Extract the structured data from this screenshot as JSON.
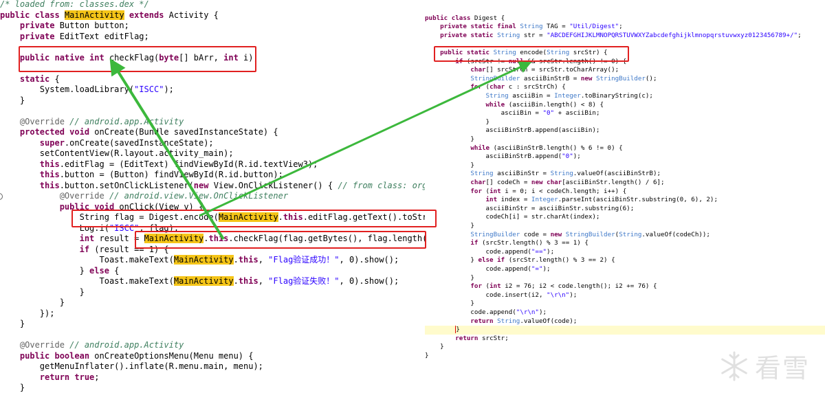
{
  "left_lines": [
    [
      [
        "cm",
        "/* loaded from: classes.dex */"
      ]
    ],
    [
      [
        "kw",
        "public class "
      ],
      [
        "hl",
        "MainActivity"
      ],
      [
        "kw",
        " extends "
      ],
      [
        "t",
        "Activity {"
      ]
    ],
    [
      [
        "t",
        "    "
      ],
      [
        "kw",
        "private "
      ],
      [
        "t",
        "Button button;"
      ]
    ],
    [
      [
        "t",
        "    "
      ],
      [
        "kw",
        "private "
      ],
      [
        "t",
        "EditText editFlag;"
      ]
    ],
    [],
    [
      [
        "t",
        "    "
      ],
      [
        "kw",
        "public native int "
      ],
      [
        "t",
        "checkFlag("
      ],
      [
        "kw",
        "byte"
      ],
      [
        "t",
        "[] bArr, "
      ],
      [
        "kw",
        "int "
      ],
      [
        "t",
        "i);"
      ]
    ],
    [],
    [
      [
        "t",
        "    "
      ],
      [
        "kw",
        "static "
      ],
      [
        "t",
        "{"
      ]
    ],
    [
      [
        "t",
        "        System.loadLibrary("
      ],
      [
        "str",
        "\"ISCC\""
      ],
      [
        "t",
        ");"
      ]
    ],
    [
      [
        "t",
        "    }"
      ]
    ],
    [],
    [
      [
        "t",
        "    "
      ],
      [
        "an",
        "@Override "
      ],
      [
        "cm",
        "// android.app.Activity"
      ]
    ],
    [
      [
        "t",
        "    "
      ],
      [
        "kw",
        "protected void "
      ],
      [
        "t",
        "onCreate(Bundle savedInstanceState) {"
      ]
    ],
    [
      [
        "t",
        "        "
      ],
      [
        "kw",
        "super"
      ],
      [
        "t",
        ".onCreate(savedInstanceState);"
      ]
    ],
    [
      [
        "t",
        "        setContentView(R.layout.activity_main);"
      ]
    ],
    [
      [
        "t",
        "        "
      ],
      [
        "kw",
        "this"
      ],
      [
        "t",
        ".editFlag = (EditText) findViewById(R.id.textView3);"
      ]
    ],
    [
      [
        "t",
        "        "
      ],
      [
        "kw",
        "this"
      ],
      [
        "t",
        ".button = (Button) findViewById(R.id.button);"
      ]
    ],
    [
      [
        "t",
        "        "
      ],
      [
        "kw",
        "this"
      ],
      [
        "t",
        ".button.setOnClickListener("
      ],
      [
        "kw",
        "new "
      ],
      [
        "t",
        "View.OnClickListener() { "
      ],
      [
        "cm",
        "// from class: org.i"
      ]
    ],
    [
      [
        "t",
        "            "
      ],
      [
        "an",
        "@Override "
      ],
      [
        "cm",
        "// android.view.View.OnClickListener"
      ]
    ],
    [
      [
        "t",
        "            "
      ],
      [
        "kw",
        "public void "
      ],
      [
        "t",
        "onClick(View v) {"
      ]
    ],
    [
      [
        "t",
        "                String flag = Digest.encode("
      ],
      [
        "hl",
        "MainActivity"
      ],
      [
        "t",
        "."
      ],
      [
        "kw",
        "this"
      ],
      [
        "t",
        ".editFlag.getText().toString"
      ]
    ],
    [
      [
        "t",
        "                Log.i("
      ],
      [
        "str",
        "\"ISCC\""
      ],
      [
        "t",
        ", flag);"
      ]
    ],
    [
      [
        "t",
        "                "
      ],
      [
        "kw",
        "int "
      ],
      [
        "t",
        "result = "
      ],
      [
        "hl",
        "MainActivity"
      ],
      [
        "t",
        "."
      ],
      [
        "kw",
        "this"
      ],
      [
        "t",
        ".checkFlag(flag.getBytes(), flag.length());"
      ]
    ],
    [
      [
        "t",
        "                "
      ],
      [
        "kw",
        "if "
      ],
      [
        "t",
        "(result == 1) {"
      ]
    ],
    [
      [
        "t",
        "                    Toast.makeText("
      ],
      [
        "hl",
        "MainActivity"
      ],
      [
        "t",
        "."
      ],
      [
        "kw",
        "this"
      ],
      [
        "t",
        ", "
      ],
      [
        "str",
        "\"Flag验证成功！\""
      ],
      [
        "t",
        ", 0).show();"
      ]
    ],
    [
      [
        "t",
        "                } "
      ],
      [
        "kw",
        "else "
      ],
      [
        "t",
        "{"
      ]
    ],
    [
      [
        "t",
        "                    Toast.makeText("
      ],
      [
        "hl",
        "MainActivity"
      ],
      [
        "t",
        "."
      ],
      [
        "kw",
        "this"
      ],
      [
        "t",
        ", "
      ],
      [
        "str",
        "\"Flag验证失败！\""
      ],
      [
        "t",
        ", 0).show();"
      ]
    ],
    [
      [
        "t",
        "                }"
      ]
    ],
    [
      [
        "t",
        "            }"
      ]
    ],
    [
      [
        "t",
        "        });"
      ]
    ],
    [
      [
        "t",
        "    }"
      ]
    ],
    [],
    [
      [
        "t",
        "    "
      ],
      [
        "an",
        "@Override "
      ],
      [
        "cm",
        "// android.app.Activity"
      ]
    ],
    [
      [
        "t",
        "    "
      ],
      [
        "kw",
        "public boolean "
      ],
      [
        "t",
        "onCreateOptionsMenu(Menu menu) {"
      ]
    ],
    [
      [
        "t",
        "        getMenuInflater().inflate(R.menu.main, menu);"
      ]
    ],
    [
      [
        "t",
        "        "
      ],
      [
        "kw",
        "return true"
      ],
      [
        "t",
        ";"
      ]
    ],
    [
      [
        "t",
        "    }"
      ]
    ]
  ],
  "right_lines": [
    [],
    [
      [
        "kw",
        "public class "
      ],
      [
        "t",
        "Digest {"
      ]
    ],
    [
      [
        "t",
        "    "
      ],
      [
        "kw",
        "private static final "
      ],
      [
        "ty",
        "String "
      ],
      [
        "t",
        "TAG = "
      ],
      [
        "str",
        "\"Util/Digest\""
      ],
      [
        "t",
        ";"
      ]
    ],
    [
      [
        "t",
        "    "
      ],
      [
        "kw",
        "private static "
      ],
      [
        "ty",
        "String "
      ],
      [
        "t",
        "str = "
      ],
      [
        "str",
        "\"ABCDEFGHIJKLMNOPQRSTUVWXYZabcdefghijklmnopqrstuvwxyz0123456789+/\""
      ],
      [
        "t",
        ";"
      ]
    ],
    [],
    [
      [
        "t",
        "    "
      ],
      [
        "kw",
        "public static "
      ],
      [
        "ty",
        "String "
      ],
      [
        "t",
        "encode("
      ],
      [
        "ty",
        "String "
      ],
      [
        "t",
        "srcStr) {"
      ]
    ],
    [
      [
        "t",
        "        "
      ],
      [
        "kw",
        "if "
      ],
      [
        "t",
        "(srcStr != "
      ],
      [
        "kw",
        "null "
      ],
      [
        "t",
        "&& srcStr.length() != 0) {"
      ]
    ],
    [
      [
        "t",
        "            "
      ],
      [
        "kw",
        "char"
      ],
      [
        "t",
        "[] srcStrCh = srcStr.toCharArray();"
      ]
    ],
    [
      [
        "t",
        "            "
      ],
      [
        "ty",
        "StringBuilder "
      ],
      [
        "t",
        "asciiBinStrB = "
      ],
      [
        "kw",
        "new "
      ],
      [
        "ty",
        "StringBuilder"
      ],
      [
        "t",
        "();"
      ]
    ],
    [
      [
        "t",
        "            "
      ],
      [
        "kw",
        "for "
      ],
      [
        "t",
        "("
      ],
      [
        "kw",
        "char "
      ],
      [
        "t",
        "c : srcStrCh) {"
      ]
    ],
    [
      [
        "t",
        "                "
      ],
      [
        "ty",
        "String "
      ],
      [
        "t",
        "asciiBin = "
      ],
      [
        "ty",
        "Integer"
      ],
      [
        "t",
        ".toBinaryString(c);"
      ]
    ],
    [
      [
        "t",
        "                "
      ],
      [
        "kw",
        "while "
      ],
      [
        "t",
        "(asciiBin.length() < 8) {"
      ]
    ],
    [
      [
        "t",
        "                    asciiBin = "
      ],
      [
        "str",
        "\"0\""
      ],
      [
        "t",
        " + asciiBin;"
      ]
    ],
    [
      [
        "t",
        "                }"
      ]
    ],
    [
      [
        "t",
        "                asciiBinStrB.append(asciiBin);"
      ]
    ],
    [
      [
        "t",
        "            }"
      ]
    ],
    [
      [
        "t",
        "            "
      ],
      [
        "kw",
        "while "
      ],
      [
        "t",
        "(asciiBinStrB.length() % 6 != 0) {"
      ]
    ],
    [
      [
        "t",
        "                asciiBinStrB.append("
      ],
      [
        "str",
        "\"0\""
      ],
      [
        "t",
        ");"
      ]
    ],
    [
      [
        "t",
        "            }"
      ]
    ],
    [
      [
        "t",
        "            "
      ],
      [
        "ty",
        "String "
      ],
      [
        "t",
        "asciiBinStr = "
      ],
      [
        "ty",
        "String"
      ],
      [
        "t",
        ".valueOf(asciiBinStrB);"
      ]
    ],
    [
      [
        "t",
        "            "
      ],
      [
        "kw",
        "char"
      ],
      [
        "t",
        "[] codeCh = "
      ],
      [
        "kw",
        "new char"
      ],
      [
        "t",
        "[asciiBinStr.length() / 6];"
      ]
    ],
    [
      [
        "t",
        "            "
      ],
      [
        "kw",
        "for "
      ],
      [
        "t",
        "("
      ],
      [
        "kw",
        "int "
      ],
      [
        "t",
        "i = 0; i < codeCh.length; i++) {"
      ]
    ],
    [
      [
        "t",
        "                "
      ],
      [
        "kw",
        "int "
      ],
      [
        "t",
        "index = "
      ],
      [
        "ty",
        "Integer"
      ],
      [
        "t",
        ".parseInt(asciiBinStr.substring(0, 6), 2);"
      ]
    ],
    [
      [
        "t",
        "                asciiBinStr = asciiBinStr.substring(6);"
      ]
    ],
    [
      [
        "t",
        "                codeCh[i] = str.charAt(index);"
      ]
    ],
    [
      [
        "t",
        "            }"
      ]
    ],
    [
      [
        "t",
        "            "
      ],
      [
        "ty",
        "StringBuilder "
      ],
      [
        "t",
        "code = "
      ],
      [
        "kw",
        "new "
      ],
      [
        "ty",
        "StringBuilder"
      ],
      [
        "t",
        "("
      ],
      [
        "ty",
        "String"
      ],
      [
        "t",
        ".valueOf(codeCh));"
      ]
    ],
    [
      [
        "t",
        "            "
      ],
      [
        "kw",
        "if "
      ],
      [
        "t",
        "(srcStr.length() % 3 == 1) {"
      ]
    ],
    [
      [
        "t",
        "                code.append("
      ],
      [
        "str",
        "\"==\""
      ],
      [
        "t",
        ");"
      ]
    ],
    [
      [
        "t",
        "            } "
      ],
      [
        "kw",
        "else if "
      ],
      [
        "t",
        "(srcStr.length() % 3 == 2) {"
      ]
    ],
    [
      [
        "t",
        "                code.append("
      ],
      [
        "str",
        "\"=\""
      ],
      [
        "t",
        ");"
      ]
    ],
    [
      [
        "t",
        "            }"
      ]
    ],
    [
      [
        "t",
        "            "
      ],
      [
        "kw",
        "for "
      ],
      [
        "t",
        "("
      ],
      [
        "kw",
        "int "
      ],
      [
        "t",
        "i2 = 76; i2 < code.length(); i2 += 76) {"
      ]
    ],
    [
      [
        "t",
        "                code.insert(i2, "
      ],
      [
        "str",
        "\"\\r\\n\""
      ],
      [
        "t",
        ");"
      ]
    ],
    [
      [
        "t",
        "            }"
      ]
    ],
    [
      [
        "t",
        "            code.append("
      ],
      [
        "str",
        "\"\\r\\n\""
      ],
      [
        "t",
        ");"
      ]
    ],
    [
      [
        "t",
        "            "
      ],
      [
        "kw",
        "return "
      ],
      [
        "ty",
        "String"
      ],
      [
        "t",
        ".valueOf(code);"
      ]
    ],
    [
      [
        "t",
        "        "
      ],
      [
        "cur",
        ""
      ],
      [
        "t",
        "}"
      ]
    ],
    [
      [
        "t",
        "        "
      ],
      [
        "kw",
        "return "
      ],
      [
        "t",
        "srcStr;"
      ]
    ],
    [
      [
        "t",
        "    }"
      ]
    ],
    [
      [
        "t",
        "}"
      ]
    ]
  ],
  "right_current_line": 37,
  "watermark": {
    "text": "看雪",
    "icon": "snowflake-icon"
  },
  "colors": {
    "annotation": "#e12020",
    "arrow": "#3cb83c",
    "class_highlight": "#f5c518",
    "current_line": "#fffbcc"
  }
}
